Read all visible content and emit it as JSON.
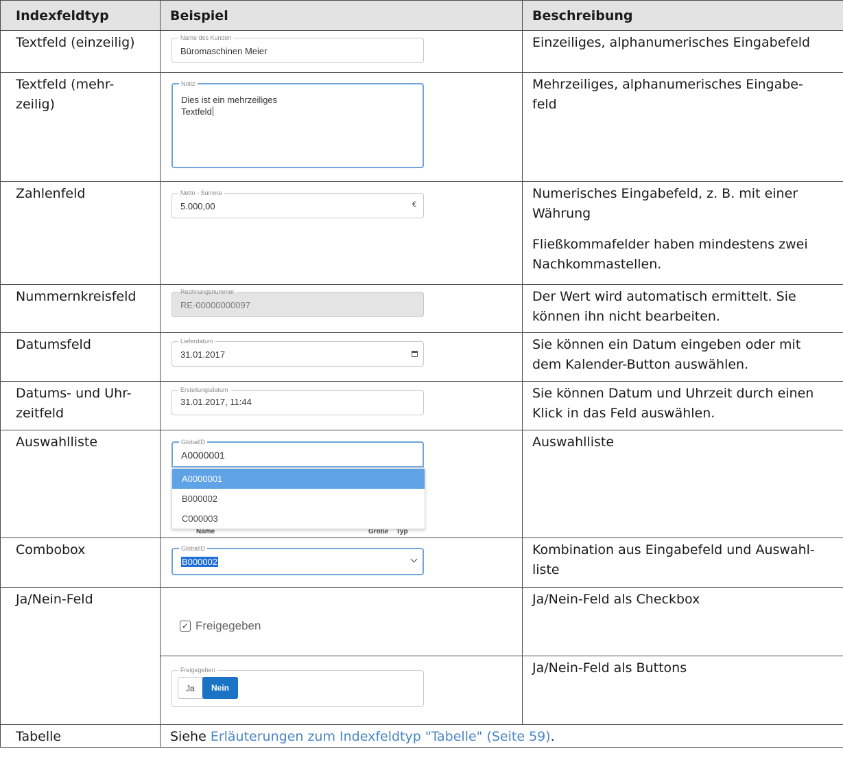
{
  "headers": {
    "type": "Indexfeldtyp",
    "example": "Beispiel",
    "description": "Beschreibung"
  },
  "rows": {
    "text_single": {
      "type": "Textfeld (einzeilig)",
      "field_label": "Name des Kunden",
      "field_value": "Büromaschinen Meier",
      "description": "Einzeiliges, alphanumerisches Eingabefeld"
    },
    "text_multi": {
      "type_line1": "Textfeld (mehr-",
      "type_line2": "zeilig)",
      "field_label": "Notiz",
      "field_value_line1": "Dies ist ein mehrzeiliges",
      "field_value_line2": "Textfeld",
      "description_line1": "Mehrzeiliges, alphanumerisches Eingabe-",
      "description_line2": "feld"
    },
    "number": {
      "type": "Zahlenfeld",
      "field_label": "Netto - Summe",
      "field_value": "5.000,00",
      "currency": "€",
      "description_line1": "Numerisches Eingabefeld, z. B. mit einer",
      "description_line2": "Währung",
      "description2_line1": "Fließkommafelder haben mindestens zwei",
      "description2_line2": "Nachkommastellen."
    },
    "sequence": {
      "type": "Nummernkreisfeld",
      "field_label": "Rechnungsnummer",
      "field_value": "RE-00000000097",
      "description_line1": "Der Wert wird automatisch ermittelt. Sie",
      "description_line2": "können ihn nicht bearbeiten."
    },
    "date": {
      "type": "Datumsfeld",
      "field_label": "Lieferdatum",
      "field_value": "31.01.2017",
      "icon": "calendar-icon",
      "description_line1": "Sie können ein Datum eingeben oder mit",
      "description_line2": "dem Kalender-Button auswählen."
    },
    "datetime": {
      "type_line1": "Datums- und Uhr-",
      "type_line2": "zeitfeld",
      "field_label": "Erstellungsdatum",
      "field_value": "31.01.2017, 11:44",
      "description_line1": "Sie können Datum und Uhrzeit durch einen",
      "description_line2": "Klick in das Feld auswählen."
    },
    "select": {
      "type": "Auswahlliste",
      "field_label": "GlobalID",
      "field_value": "A0000001",
      "options": [
        "A0000001",
        "B000002",
        "C000003"
      ],
      "behind_left": "Name",
      "behind_right": "Größe    Typ",
      "description": "Auswahlliste"
    },
    "combobox": {
      "type": "Combobox",
      "field_label": "GlobalID",
      "field_value": "B000002",
      "icon": "chevron-down-icon",
      "description_line1": "Kombination aus Eingabefeld und Auswahl-",
      "description_line2": "liste"
    },
    "yesno": {
      "type": "Ja/Nein-Feld",
      "checkbox_label": "Freigegeben",
      "checkbox_checked": true,
      "description_checkbox": "Ja/Nein-Feld als Checkbox",
      "buttons_label": "Freigegeben",
      "button_yes": "Ja",
      "button_no": "Nein",
      "selected": "Nein",
      "description_buttons": "Ja/Nein-Feld als Buttons"
    },
    "table": {
      "type": "Tabelle",
      "prefix": "Siehe ",
      "link": "Erläuterungen zum Indexfeldtyp \"Tabelle\" (Seite 59)",
      "suffix": "."
    }
  },
  "colors": {
    "header_bg": "#e3e3e3",
    "focus_border": "#6ea6dc",
    "selected_option": "#5fa3e6",
    "button_active": "#1a73c4",
    "link": "#4a86c4"
  }
}
